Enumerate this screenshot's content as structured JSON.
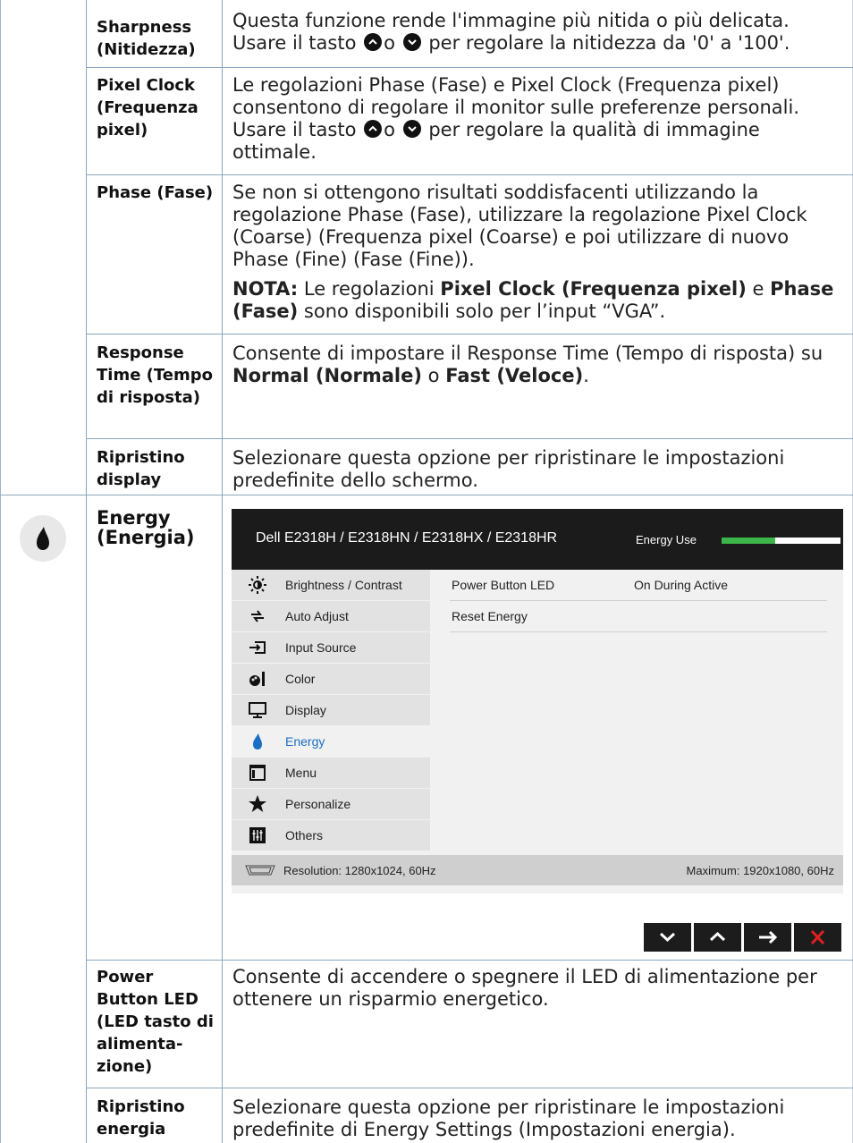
{
  "rows": [
    {
      "term": "Sharpness (Nitidezza)",
      "desc": "Questa funzione rende l'immagine più nitida o più delicata.",
      "desc2a": "Usare il tasto",
      "desc2b": "o",
      "desc2c": "per regolare la nitidezza da '0' a '100'."
    },
    {
      "term": "Pixel Clock (Frequenza pixel)",
      "desc": "Le regolazioni Phase (Fase) e Pixel Clock (Frequenza pixel) consentono di regolare il monitor sulle preferenze personali.",
      "desc2a": "Usare il tasto",
      "desc2b": "o",
      "desc2c": "per regolare la qualità di immagine ottimale."
    },
    {
      "term": "Phase (Fase)",
      "desc": "Se non si ottengono risultati soddisfacenti utilizzando la regolazione Phase (Fase), utilizzare la regolazione Pixel Clock (Coarse) (Frequenza pixel (Coarse) e poi utilizzare di nuovo Phase (Fine) (Fase (Fine)).",
      "note_label": "NOTA:",
      "note_a": "Le regolazioni",
      "note_b": "Pixel Clock (Frequenza pixel)",
      "note_c": "e",
      "note_d": "Phase (Fase)",
      "note_e": "sono disponibili solo per l’input “VGA”."
    },
    {
      "term": "Response Time (Tempo di risposta)",
      "desc": "Consente di impostare il Response Time (Tempo di risposta) su",
      "b1": "Normal (Normale)",
      "mid": "o",
      "b2": "Fast (Veloce)",
      "end": "."
    },
    {
      "term": "Ripristino display",
      "desc": "Selezionare questa opzione per ripristinare le impostazioni predefinite dello schermo."
    },
    {
      "term": "Energy (Energia)"
    },
    {
      "term": "Power Button LED (LED tasto di alimenta-zione)",
      "desc": "Consente di accendere o spegnere il LED di alimentazione per ottenere un risparmio energetico."
    },
    {
      "term": "Ripristino energia",
      "desc": "Selezionare questa opzione per ripristinare le impostazioni predefinite di Energy Settings (Impostazioni energia)."
    }
  ],
  "osd": {
    "title": "Dell E2318H / E2318HN / E2318HX / E2318HR",
    "energy_use_label": "Energy Use",
    "energy_use_level": 0.45,
    "menu": [
      {
        "label": "Brightness / Contrast",
        "icon": "brightness-icon"
      },
      {
        "label": "Auto Adjust",
        "icon": "auto-adjust-icon"
      },
      {
        "label": "Input Source",
        "icon": "input-source-icon"
      },
      {
        "label": "Color",
        "icon": "color-icon"
      },
      {
        "label": "Display",
        "icon": "display-icon"
      },
      {
        "label": "Energy",
        "icon": "energy-icon",
        "active": true
      },
      {
        "label": "Menu",
        "icon": "menu-icon"
      },
      {
        "label": "Personalize",
        "icon": "star-icon"
      },
      {
        "label": "Others",
        "icon": "others-icon"
      }
    ],
    "settings": [
      {
        "label": "Power Button LED",
        "value": "On During Active"
      },
      {
        "label": "Reset Energy",
        "value": ""
      }
    ],
    "resolution": "Resolution: 1280x1024, 60Hz",
    "maximum": "Maximum: 1920x1080, 60Hz",
    "colors": {
      "accent": "#1a6fc2",
      "energy_bar": "#3cb54a",
      "close": "#e02020"
    }
  }
}
